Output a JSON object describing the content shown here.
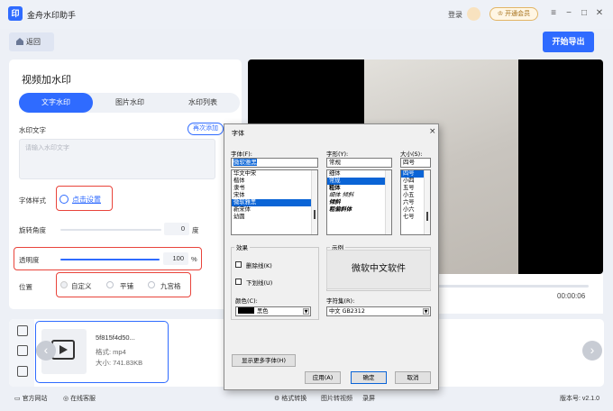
{
  "app": {
    "title": "金舟水印助手",
    "logo_text": "印"
  },
  "header": {
    "login": "登录",
    "vip_button": "开通会员",
    "win_menu": "≡",
    "win_min": "−",
    "win_max": "□",
    "win_close": "✕"
  },
  "toolbar": {
    "back_label": "返回",
    "export_label": "开始导出"
  },
  "panel": {
    "title": "视频加水印",
    "tabs": [
      {
        "label": "文字水印",
        "active": true
      },
      {
        "label": "图片水印",
        "active": false
      },
      {
        "label": "水印列表",
        "active": false
      }
    ],
    "watermark_text_label": "水印文字",
    "batch_add": "再次添加",
    "text_placeholder": "请输入水印文字",
    "font_style_label": "字体样式",
    "font_style_link": "点击设置",
    "rotation_label": "旋转角度",
    "rotation_value": "0",
    "rotation_unit": "度",
    "opacity_label": "透明度",
    "opacity_value": "100",
    "opacity_unit": "%",
    "position_label": "位置",
    "position_options": [
      "自定义",
      "平铺",
      "九宫格"
    ]
  },
  "player": {
    "time": "00:00:06"
  },
  "file": {
    "name": "5f815f4d50...",
    "format": "格式: mp4",
    "size": "大小: 741.83KB"
  },
  "footer": {
    "website": "官方网站",
    "support": "在线客服",
    "format_convert": "格式转换",
    "image_to_video": "图片转视频",
    "screen_record": "录屏",
    "version": "版本号: v2.1.0"
  },
  "font_dialog": {
    "title": "字体",
    "close": "×",
    "font_label": "字体(F):",
    "font_value": "微软雅黑",
    "fonts": [
      "华文中宋",
      "楷体",
      "隶书",
      "宋体",
      "微软雅黑",
      "新宋体",
      "幼圆"
    ],
    "style_label": "字形(Y):",
    "style_value": "常规",
    "styles": [
      "细体",
      "常规",
      "粗体",
      "细体 倾斜",
      "倾斜",
      "粗偏斜体"
    ],
    "size_label": "大小(S):",
    "size_value": "四号",
    "sizes": [
      "四号",
      "小四",
      "五号",
      "小五",
      "六号",
      "小六",
      "七号"
    ],
    "effects_label": "效果",
    "strikeout": "删除线(K)",
    "underline": "下划线(U)",
    "color_label": "颜色(C):",
    "color_value": "黑色",
    "sample_label": "示例",
    "sample_text": "微软中文软件",
    "charset_label": "字符集(R):",
    "charset_value": "中文 GB2312",
    "more_fonts": "显示更多字体(H)",
    "apply": "应用(A)",
    "ok": "确定",
    "cancel": "取消"
  },
  "colors": {
    "accent": "#2f6bff",
    "highlight_border": "#e9443b",
    "selection": "#0a64d6"
  }
}
